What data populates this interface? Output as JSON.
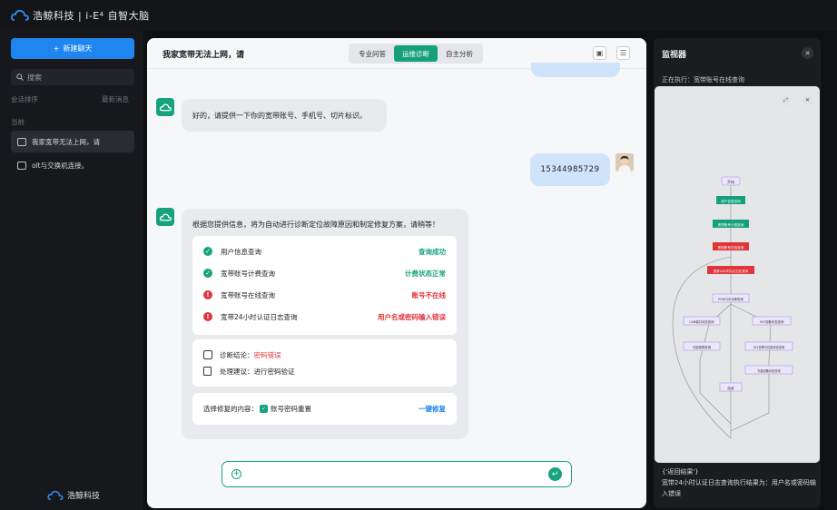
{
  "topbar": {
    "brand": "浩鲸科技 | i-E⁴ 自智大脑"
  },
  "sidebar": {
    "new_chat": "新建聊天",
    "search_placeholder": "搜索",
    "sort_label": "会话排序",
    "sort_value": "最新消息",
    "group_label": "当前",
    "conversations": [
      {
        "title": "我家宽带无法上网，请"
      },
      {
        "title": "olt与交换机连接。"
      }
    ],
    "footer_logo": "浩鲸科技"
  },
  "main": {
    "title": "我家宽带无法上网，请",
    "tabs": [
      {
        "label": "专业问答"
      },
      {
        "label": "运维诊断",
        "active": true
      },
      {
        "label": "自主分析"
      }
    ],
    "messages": {
      "bot1": "好的，请提供一下你的宽带账号、手机号、切片标识。",
      "user1": "15344985729",
      "bot2_intro": "根据您提供信息，将为自动进行诊断定位故障原因和制定修复方案，请稍等！"
    },
    "checks": [
      {
        "label": "用户信息查询",
        "status": "查询成功",
        "ok": true
      },
      {
        "label": "宽带账号计费查询",
        "status": "计费状态正常",
        "ok": true
      },
      {
        "label": "宽带账号在线查询",
        "status": "账号不在线",
        "ok": false
      },
      {
        "label": "宽带24小时认证日志查询",
        "status": "用户名或密码输入错误",
        "ok": false
      }
    ],
    "conclusion_label": "诊断结论：",
    "conclusion_value": "密码错误",
    "suggestion": "处理建议：进行密码验证",
    "repair_prompt": "选择修复的内容：",
    "repair_option": "账号密码重置",
    "repair_button": "一键修复"
  },
  "monitor": {
    "title": "监视器",
    "running": "正在执行：宽带账号在线查询",
    "result_tag": "{'返回结果'}",
    "result_text": "宽带24小时认证日志查询执行结果为：用户名或密码输入错误",
    "flow_nodes": [
      "开始",
      "用户信息查询",
      "宽带账号计费查询",
      "宽带账号在线查询",
      "宽带24小时认证日志查询",
      "PON口光功率查询",
      "LAN端口状态查询",
      "OLT设备状态查询",
      "可能故障查询",
      "OLT告警与性能状态查询",
      "光猫设备状态查询",
      "结束"
    ]
  },
  "colors": {
    "accent": "#16a37e",
    "primary": "#1f86f0",
    "error": "#e0353b"
  }
}
